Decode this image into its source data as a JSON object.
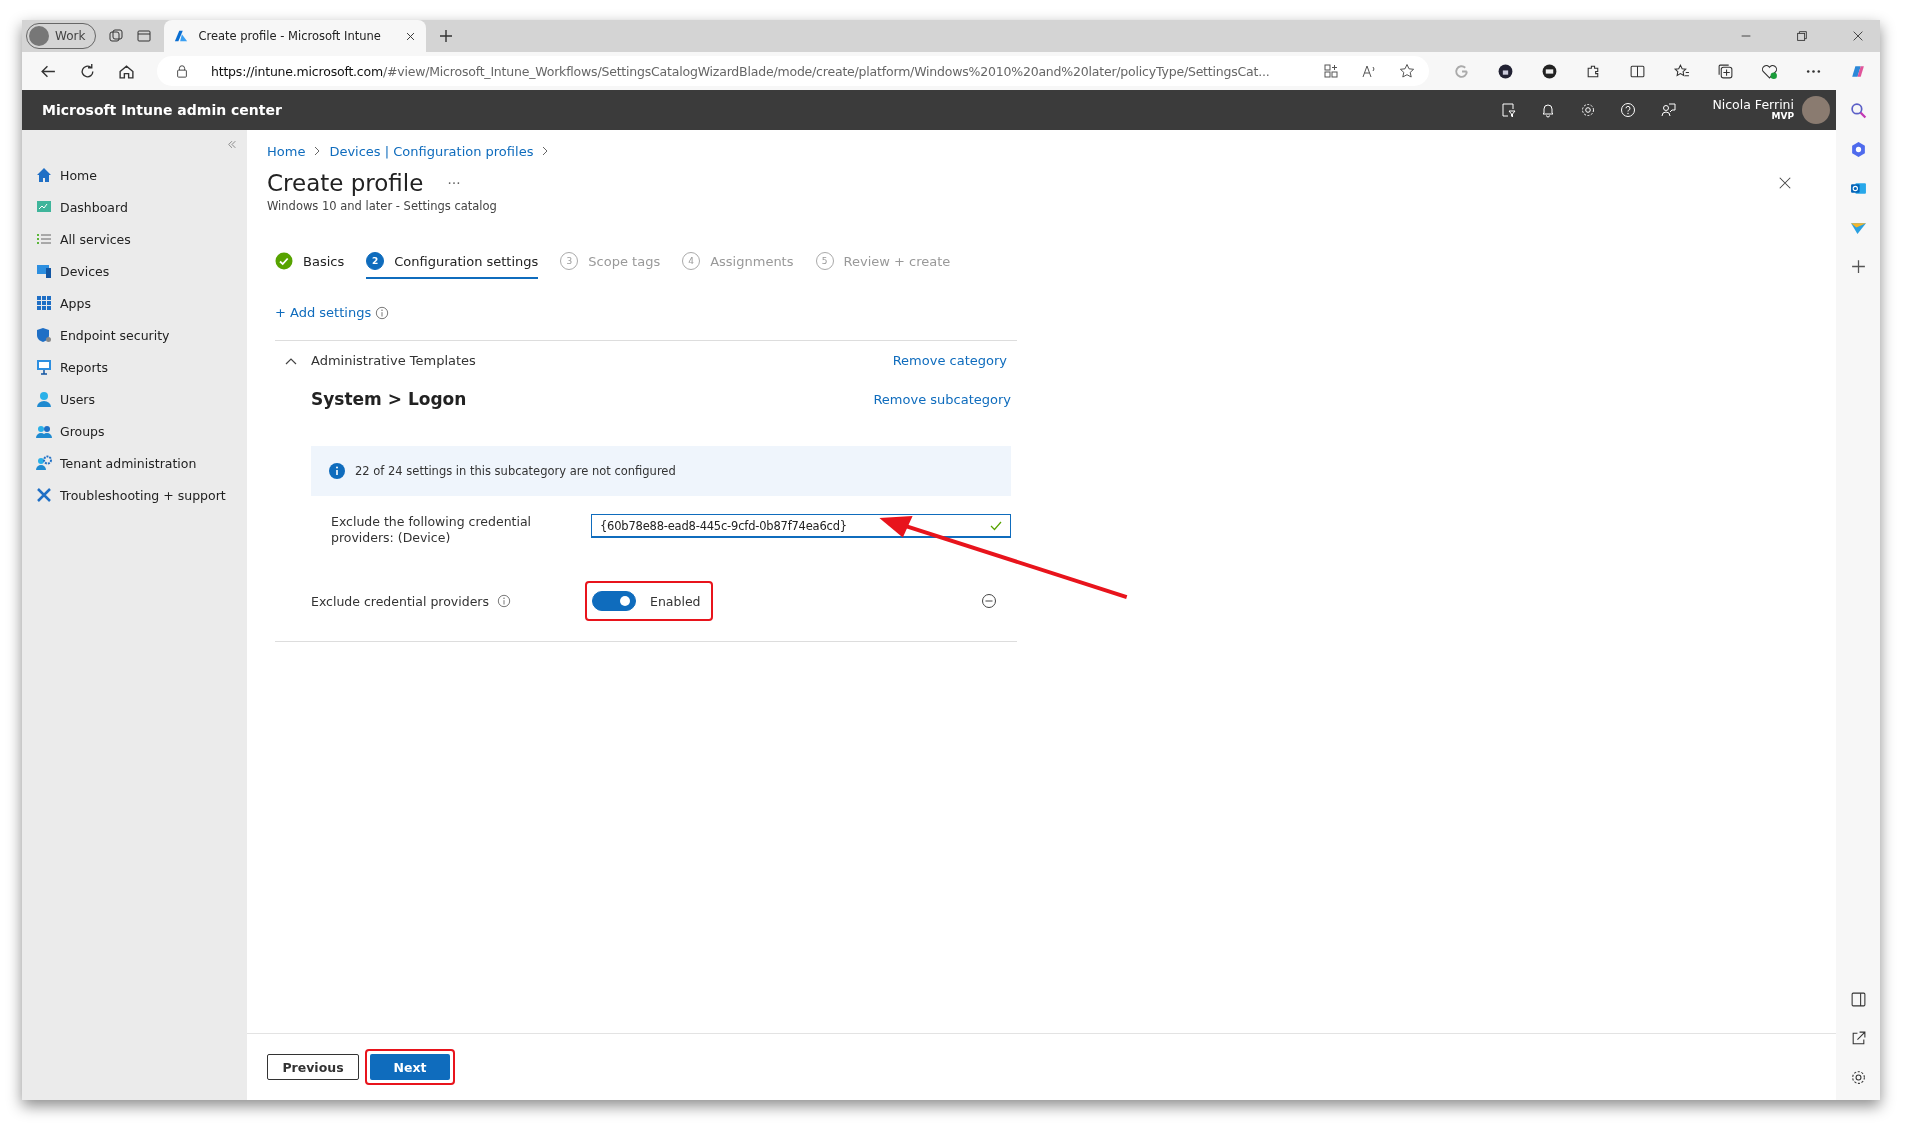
{
  "browser": {
    "profile": "Work",
    "tab_title": "Create profile - Microsoft Intune",
    "url_host": "https://intune.microsoft.com",
    "url_path": "/#view/Microsoft_Intune_Workflows/SettingsCatalogWizardBlade/mode/create/platform/Windows%2010%20and%20later/policyType/SettingsCat..."
  },
  "header": {
    "title": "Microsoft Intune admin center",
    "user_name": "Nicola Ferrini",
    "user_badge": "MVP"
  },
  "sidebar": {
    "items": [
      {
        "label": "Home",
        "selected": false
      },
      {
        "label": "Dashboard",
        "selected": false
      },
      {
        "label": "All services",
        "selected": false
      },
      {
        "label": "Devices",
        "selected": false
      },
      {
        "label": "Apps",
        "selected": false
      },
      {
        "label": "Endpoint security",
        "selected": false
      },
      {
        "label": "Reports",
        "selected": false
      },
      {
        "label": "Users",
        "selected": false
      },
      {
        "label": "Groups",
        "selected": false
      },
      {
        "label": "Tenant administration",
        "selected": false
      },
      {
        "label": "Troubleshooting + support",
        "selected": false
      }
    ]
  },
  "breadcrumbs": [
    "Home",
    "Devices | Configuration profiles"
  ],
  "page": {
    "title": "Create profile",
    "subtitle": "Windows 10 and later - Settings catalog"
  },
  "steps": [
    {
      "label": "Basics",
      "completed": true,
      "selected": false
    },
    {
      "number": "2",
      "label": "Configuration settings",
      "completed": false,
      "selected": true
    },
    {
      "number": "3",
      "label": "Scope tags",
      "completed": false,
      "selected": false
    },
    {
      "number": "4",
      "label": "Assignments",
      "completed": false,
      "selected": false
    },
    {
      "number": "5",
      "label": "Review + create",
      "completed": false,
      "selected": false
    }
  ],
  "add_settings": "+ Add settings",
  "category": {
    "name": "Administrative Templates",
    "expanded": true,
    "remove_label": "Remove category",
    "subcategory": {
      "name": "System > Logon",
      "remove_label": "Remove subcategory",
      "info": "22 of 24 settings in this subcategory are not configured",
      "settings": [
        {
          "kind": "text",
          "label": "Exclude the following credential providers: (Device)",
          "value": "{60b78e88-ead8-445c-9cfd-0b87f74ea6cd}",
          "valid": true
        },
        {
          "kind": "toggle",
          "label": "Exclude credential providers",
          "on": true,
          "status": "Enabled"
        }
      ]
    }
  },
  "footer": {
    "buttons": [
      {
        "label": "Previous",
        "kind": "secondary"
      },
      {
        "label": "Next",
        "kind": "primary"
      }
    ]
  }
}
